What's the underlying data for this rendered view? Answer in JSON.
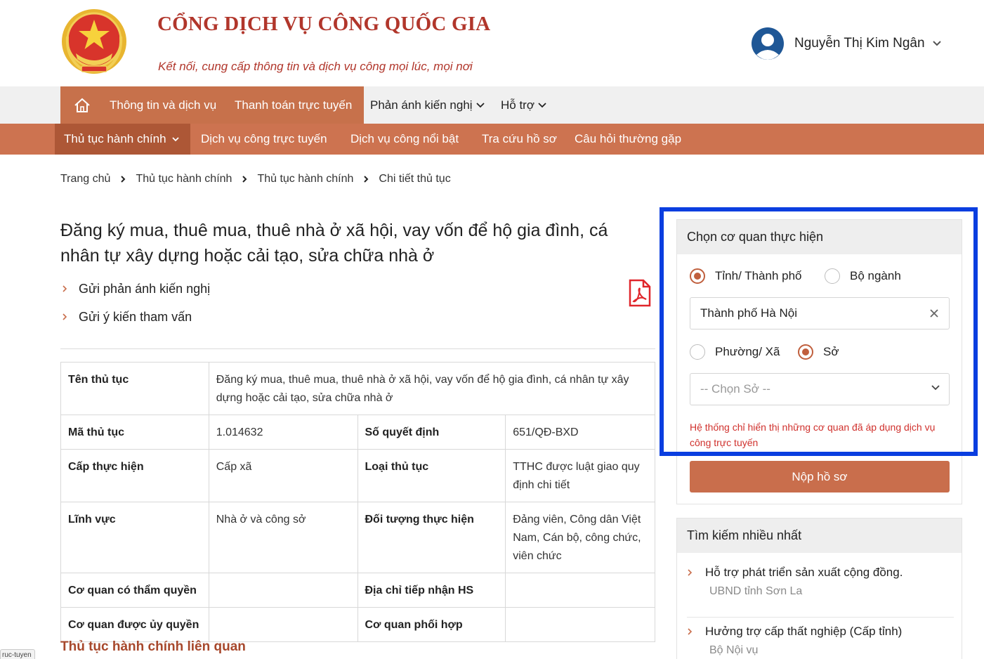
{
  "header": {
    "site_title": "CỔNG DỊCH VỤ CÔNG QUỐC GIA",
    "slogan": "Kết nối, cung cấp thông tin và dịch vụ công mọi lúc, mọi nơi",
    "user_name": "Nguyễn Thị Kim Ngân"
  },
  "nav_primary": {
    "items": [
      "Thông tin và dịch vụ",
      "Thanh toán trực tuyến",
      "Phản ánh kiến nghị",
      "Hỗ trợ"
    ]
  },
  "nav_secondary": {
    "items": [
      "Thủ tục hành chính",
      "Dịch vụ công trực tuyến",
      "Dịch vụ công nổi bật",
      "Tra cứu hồ sơ",
      "Câu hỏi thường gặp"
    ]
  },
  "breadcrumb": [
    "Trang chủ",
    "Thủ tục hành chính",
    "Thủ tục hành chính",
    "Chi tiết thủ tục"
  ],
  "procedure": {
    "title": "Đăng ký mua, thuê mua, thuê nhà ở xã hội, vay vốn để hộ gia đình, cá nhân tự xây dựng hoặc cải tạo, sửa chữa nhà ở",
    "links": [
      "Gửi phản ánh kiến nghị",
      "Gửi ý kiến tham vấn"
    ]
  },
  "table": {
    "name_label": "Tên thủ tục",
    "name_value": "Đăng ký mua, thuê mua, thuê nhà ở xã hội, vay vốn để hộ gia đình, cá nhân tự xây dựng hoặc cải tạo, sửa chữa nhà ở",
    "code_label": "Mã thủ tục",
    "code_value": "1.014632",
    "decision_label": "Số quyết định",
    "decision_value": "651/QĐ-BXD",
    "level_label": "Cấp thực hiện",
    "level_value": "Cấp xã",
    "type_label": "Loại thủ tục",
    "type_value": "TTHC được luật giao quy định chi tiết",
    "field_label": "Lĩnh vực",
    "field_value": "Nhà ở và công sở",
    "target_label": "Đối tượng thực hiện",
    "target_value": "Đảng viên, Công dân Việt Nam, Cán bộ, công chức, viên chức",
    "authority_label": "Cơ quan có thẩm quyền",
    "authority_value": "",
    "address_label": "Địa chỉ tiếp nhận HS",
    "address_value": "",
    "delegated_label": "Cơ quan được ủy quyền",
    "delegated_value": "",
    "coordinate_label": "Cơ quan phối hợp",
    "coordinate_value": ""
  },
  "related_title": "Thủ tục hành chính liên quan",
  "agency_panel": {
    "title": "Chọn cơ quan thực hiện",
    "radio_province": "Tỉnh/ Thành phố",
    "radio_ministry": "Bộ ngành",
    "province_value": "Thành phố Hà Nội",
    "radio_ward": "Phường/ Xã",
    "radio_department": "Sở",
    "department_placeholder": "-- Chọn Sở --",
    "note": "Hệ thống chỉ hiển thị những cơ quan đã áp dụng dịch vụ công trực tuyến",
    "submit_label": "Nộp hồ sơ"
  },
  "popular_panel": {
    "title": "Tìm kiếm nhiều nhất",
    "items": [
      {
        "title": "Hỗ trợ phát triển sản xuất cộng đồng.",
        "agency": "UBND tỉnh Sơn La"
      },
      {
        "title": "Hưởng trợ cấp thất nghiệp (Cấp tỉnh)",
        "agency": "Bộ Nội vụ"
      }
    ]
  },
  "corner_tag": "ruc-tuyen",
  "colors": {
    "brand_red": "#b1362b",
    "nav_orange": "#cd7350",
    "highlight_blue": "#0a3ee0"
  }
}
